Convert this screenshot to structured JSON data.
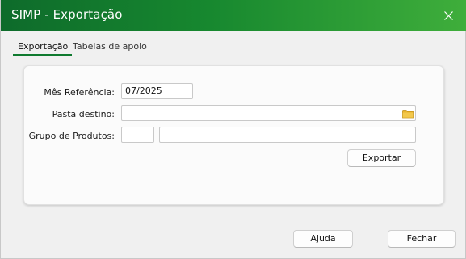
{
  "window": {
    "title": "SIMP - Exportação",
    "close_icon": "close-icon",
    "colors": {
      "titlebar_start": "#0e6b2b",
      "titlebar_end": "#3fae3b",
      "tab_underline": "#0f7a2f",
      "folder_icon": "#e9b52f"
    }
  },
  "tabs": [
    {
      "label": "Exportação",
      "active": true
    },
    {
      "label": "Tabelas de apoio",
      "active": false
    }
  ],
  "form": {
    "mes_referencia": {
      "label": "Mês Referência:",
      "value": "07/2025"
    },
    "pasta_destino": {
      "label": "Pasta destino:",
      "value": "",
      "icon": "folder-icon"
    },
    "grupo_produtos": {
      "label": "Grupo de Produtos:",
      "code": "",
      "description": ""
    },
    "exportar_label": "Exportar"
  },
  "footer": {
    "ajuda_label": "Ajuda",
    "fechar_label": "Fechar"
  }
}
